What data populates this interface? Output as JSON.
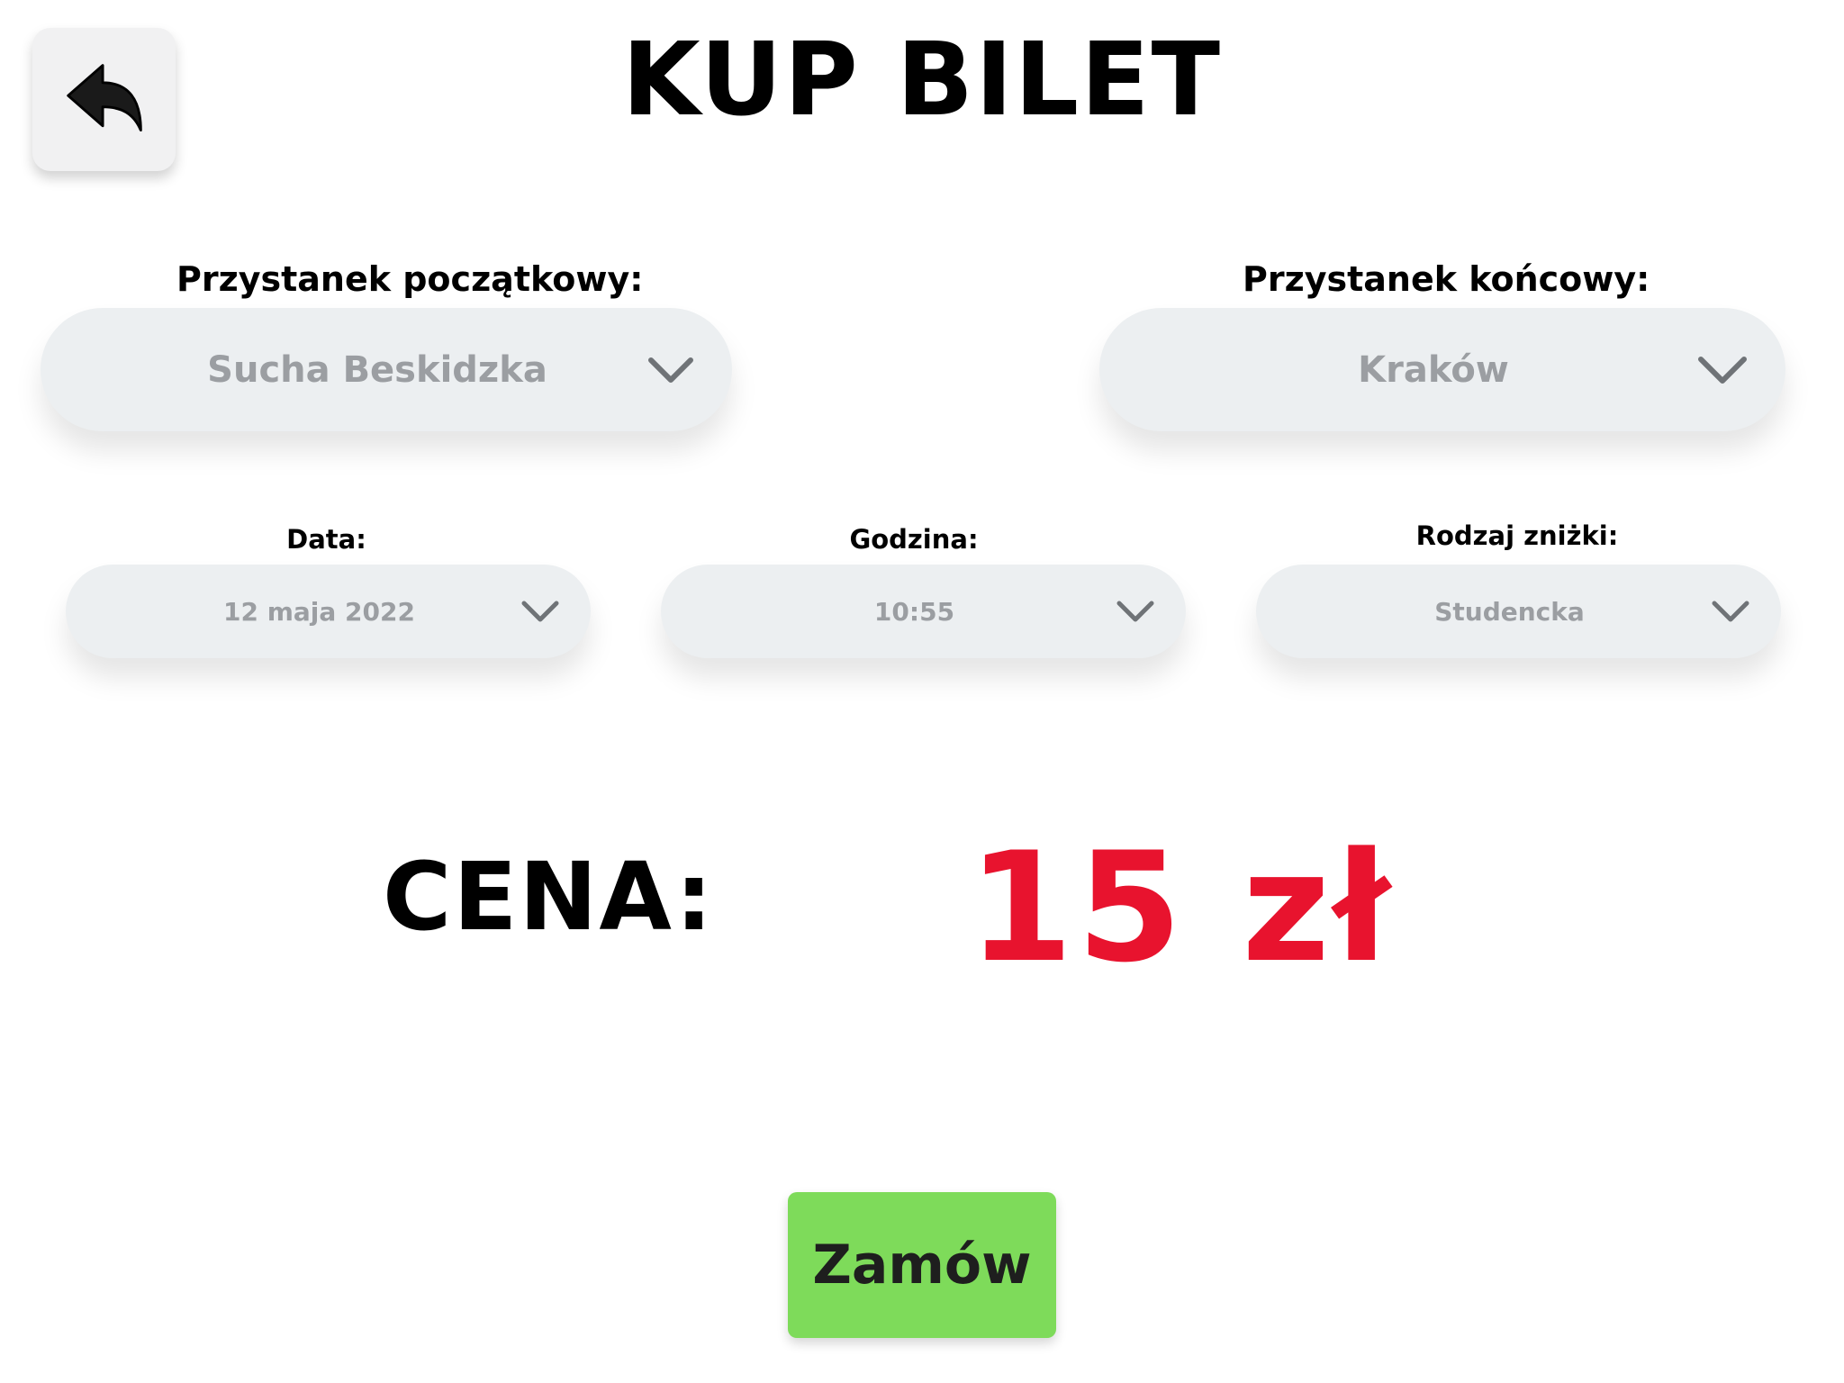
{
  "header": {
    "title": "KUP BILET",
    "back_icon": "reply-arrow-icon"
  },
  "form": {
    "start_stop": {
      "label": "Przystanek początkowy:",
      "value": "Sucha Beskidzka",
      "icon": "chevron-down-icon"
    },
    "end_stop": {
      "label": "Przystanek końcowy:",
      "value": "Kraków",
      "icon": "chevron-down-icon"
    },
    "date": {
      "label": "Data:",
      "value": "12 maja 2022",
      "icon": "chevron-down-icon"
    },
    "time": {
      "label": "Godzina:",
      "value": "10:55",
      "icon": "chevron-down-icon"
    },
    "discount": {
      "label": "Rodzaj zniżki:",
      "value": "Studencka",
      "icon": "chevron-down-icon"
    }
  },
  "price": {
    "label": "CENA:",
    "value": "15 zł"
  },
  "actions": {
    "order_label": "Zamów"
  },
  "colors": {
    "price": "#e8132e",
    "order_button": "#7edb5a",
    "dropdown_bg": "#eceff1",
    "dropdown_text": "#9b9ea2"
  }
}
